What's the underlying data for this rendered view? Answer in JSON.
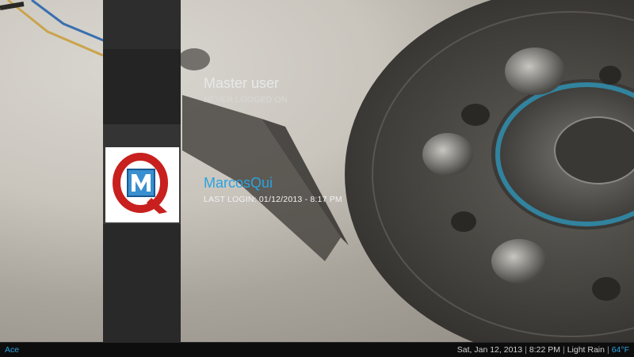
{
  "users": [
    {
      "name": "Master user",
      "status": "NEVER LOGGED ON"
    },
    {
      "name": "MarcosQui",
      "status": "LAST LOGIN: 01/12/2013 - 8:17 PM",
      "avatar_letters": "QM"
    }
  ],
  "statusbar": {
    "profile": "Ace",
    "date": "Sat, Jan 12, 2013",
    "separator": "|",
    "time": "8:22 PM",
    "weather": "Light Rain",
    "temperature": "64°F"
  },
  "colors": {
    "accent": "#2aa3e0",
    "panel": "#262626",
    "text": "#e8e8e8"
  }
}
